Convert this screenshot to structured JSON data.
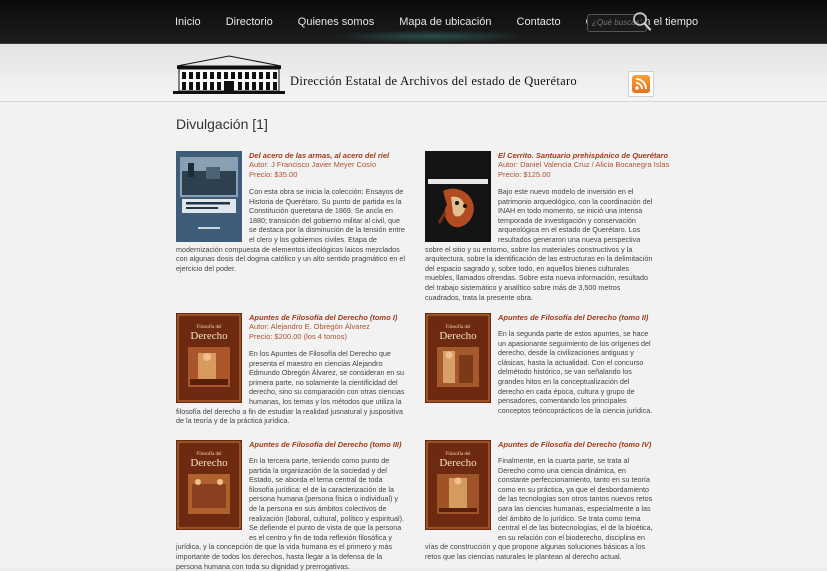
{
  "nav": {
    "items": [
      "Inicio",
      "Directorio",
      "Quienes somos",
      "Mapa de ubicación",
      "Contacto",
      "Querétaro en el tiempo"
    ],
    "search_placeholder": "¿Qué buscas?"
  },
  "header": {
    "title": "Dirección Estatal de Archivos del estado de Querétaro"
  },
  "page": {
    "title": "Divulgación [1]"
  },
  "books": [
    {
      "title": "Del acero de las armas, al acero del riel",
      "author": "Autor: J Francisco Javier Meyer Cosío",
      "price": "Precio: $35.00",
      "description": "Con esta obra se inicia la colección: Ensayos de Historia de Querétaro. Su punto de partida es la Constitución queretana de 1869. Se ancla en 1880; transición del gobierno militar al civil, que se destaca por la disminución de la tensión entre el clero y los gobiernos civiles. Etapa de modernización compuesta de elementos ideológicos laicos mezclados con algunas dosis del dogma católico y un alto sentido pragmático en el ejercicio del poder."
    },
    {
      "title": "El Cerrito. Santuario prehispánico de Querétaro",
      "author": "Autor: Daniel Valencia Cruz / Alicia Bocanegra Islas",
      "price": "Precio: $125.00",
      "description": "Bajo este nuevo modelo de inversión en el patrimonio arqueológico, con la coordinación del INAH en todo momento, se inició una intensa temporada de investigación y conservación arqueológica en el estado de Querétaro. Los resultados generaron una nueva perspectiva sobre el sitio y su entorno, sobre los materiales constructivos y la arquitectura, sobre la identificación de las estructuras en la delimitación del espacio sagrado y, sobre todo, en aquellos bienes culturales muebles, llamados ofrendas. Sobre esta nueva información, resultado del trabajo sistemático y analítico sobre más de 3,500 metros cuadrados, trata la presente obra."
    },
    {
      "title": "Apuntes de Filosofía del Derecho (tomo I)",
      "author": "Autor: Alejandro E. Obregón Álvarez",
      "price": "Precio: $200.00 (los 4 tomos)",
      "description": "En los Apuntes de Filosofía del Derecho que presenta el maestro en ciencias Alejandro Edmundo Obregón Álvarez, se consideran en su primera parte, no solamente la cientificidad del derecho, sino su comparación con otras ciencias humanas, los temas y los métodos que utiliza la filosofía del derecho a fin de estudiar la realidad jusnatural y juspositiva de la teoría y de la práctica jurídica."
    },
    {
      "title": "Apuntes de Filosofía del Derecho (tomo II)",
      "author": "",
      "price": "",
      "description": "En la segunda parte de estos apuntes, se hace un apasionante seguimiento de los orígenes del derecho, desde la civilizaciones antiguas y clásicas, hasta la actualidad. Con el concurso delmétodo histórico, se van señalando los grandes hitos en la conceptualización del derecho en cada época, cultura y grupo de pensadores, comentando los principales conceptos teóricoprácticos de la ciencia jurídica."
    },
    {
      "title": "Apuntes de Filosofía del Derecho (tomo III)",
      "author": "",
      "price": "",
      "description": "En la tercera parte, teniendo como punto de partida la organización de la sociedad y del Estado, se aborda el tema central de toda filosofía jurídica: el de la caracterización de la persona humana (persona física o individual) y de la persona en sus ámbitos colectivos de realización (laboral, cultural, político y espiritual). Se defiende el punto de vista de que la persona es el centro y fin de toda reflexión filosófica y jurídica, y la concepción de que la vida humana es el primero y más importante de todos los derechos, hasta llegar a la defensa de la persona humana con toda su dignidad y prerrogativas."
    },
    {
      "title": "Apuntes de Filosofía del Derecho (tomo IV)",
      "author": "",
      "price": "",
      "description": "Finalmente, en la cuarta parte, se trata al Derecho como una ciencia dinámica, en constante perfeccionamiento, tanto en su teoría como en su práctica, ya que el desbordamiento de las tecnologías son otros tantos nuevos retos para las ciencias humanas, especialmente a las del ámbito de lo jurídico. Se trata como tema central el de las biotecnologías, el de la bioética, en su relación con el bioderecho, disciplina en vías de construcción y que propone algunas soluciones básicas a los retos que las ciencias naturales le plantean al derecho actual."
    }
  ],
  "cover_text": {
    "derecho_top": "Filosofía del",
    "derecho_main": "Derecho"
  }
}
